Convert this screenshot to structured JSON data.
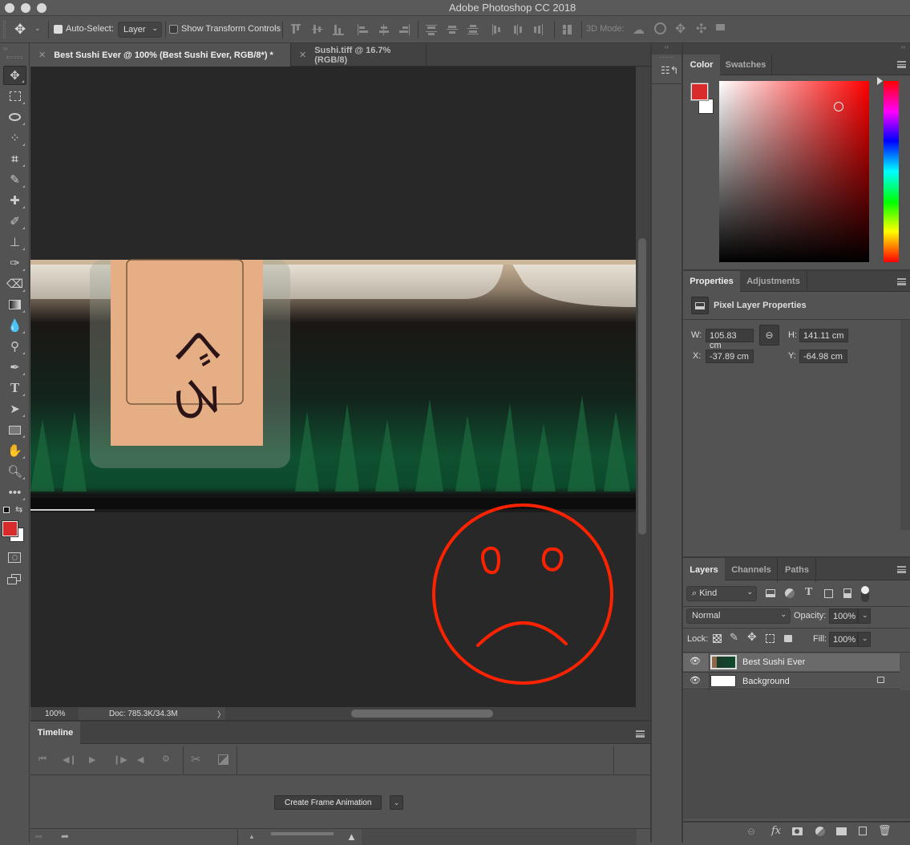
{
  "app": {
    "title": "Adobe Photoshop CC 2018"
  },
  "options_bar": {
    "auto_select_label": "Auto-Select:",
    "auto_select_checked": true,
    "auto_select_target": "Layer",
    "show_transform_label": "Show Transform Controls",
    "show_transform_checked": false,
    "mode_3d_label": "3D Mode:"
  },
  "tabs": [
    {
      "label": "Best Sushi Ever @ 100% (Best Sushi Ever, RGB/8*) *",
      "active": true
    },
    {
      "label": "Sushi.tiff @ 16.7% (RGB/8)",
      "active": false
    }
  ],
  "tools": [
    "move",
    "marquee",
    "lasso",
    "quick-selection",
    "crop",
    "eyedropper",
    "healing-brush",
    "brush",
    "clone-stamp",
    "history-brush",
    "eraser",
    "gradient",
    "blur",
    "dodge",
    "pen",
    "type",
    "path-selection",
    "rectangle",
    "hand",
    "zoom",
    "more"
  ],
  "colors": {
    "foreground": "#d92b2b",
    "background": "#ffffff",
    "accent_red": "#ff2200"
  },
  "canvas": {
    "photo_text": "ぐろ",
    "drawing": "sad-face"
  },
  "status": {
    "zoom": "100%",
    "doc": "Doc: 785.3K/34.3M"
  },
  "timeline": {
    "title": "Timeline",
    "create_button": "Create Frame Animation"
  },
  "color_panel": {
    "tabs": [
      "Color",
      "Swatches"
    ]
  },
  "properties_panel": {
    "tabs": [
      "Properties",
      "Adjustments"
    ],
    "header": "Pixel Layer Properties",
    "w_label": "W:",
    "w_value": "105.83 cm",
    "h_label": "H:",
    "h_value": "141.11 cm",
    "x_label": "X:",
    "x_value": "-37.89 cm",
    "y_label": "Y:",
    "y_value": "-64.98 cm"
  },
  "layers_panel": {
    "tabs": [
      "Layers",
      "Channels",
      "Paths"
    ],
    "filter_kind": "Kind",
    "blend_mode": "Normal",
    "opacity_label": "Opacity:",
    "opacity": "100%",
    "lock_label": "Lock:",
    "fill_label": "Fill:",
    "fill": "100%",
    "layers": [
      {
        "name": "Best Sushi Ever",
        "visible": true,
        "selected": true,
        "locked": false
      },
      {
        "name": "Background",
        "visible": true,
        "selected": false,
        "locked": true
      }
    ]
  }
}
